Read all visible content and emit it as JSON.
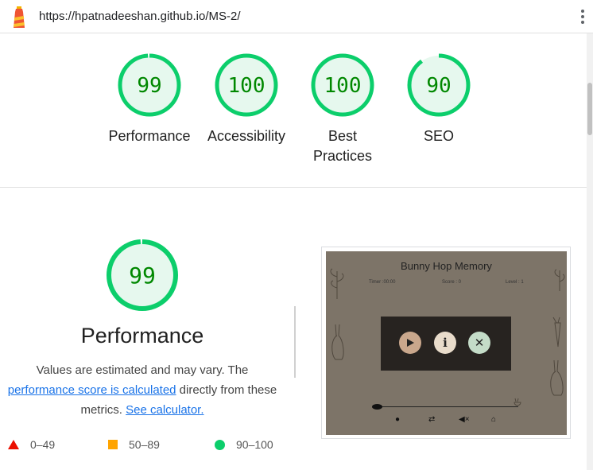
{
  "topbar": {
    "url": "https://hpatnadeeshan.github.io/MS-2/"
  },
  "gauges": [
    {
      "score": "99",
      "label": "Performance",
      "value": 99
    },
    {
      "score": "100",
      "label": "Accessibility",
      "value": 100
    },
    {
      "score": "100",
      "label_line1": "Best",
      "label_line2": "Practices",
      "value": 100
    },
    {
      "score": "90",
      "label": "SEO",
      "value": 90
    }
  ],
  "performance": {
    "score": "99",
    "value": 99,
    "title": "Performance",
    "desc_1": "Values are estimated and may vary. The",
    "desc_link_1": "performance score is calculated",
    "desc_2": " directly from these",
    "desc_3": "metrics. ",
    "desc_link_2": "See calculator."
  },
  "legend": [
    {
      "range": "0–49",
      "color": "#eb0f00"
    },
    {
      "range": "50–89",
      "color": "#ffa400"
    },
    {
      "range": "90–100",
      "color": "#0cce6b"
    }
  ],
  "thumbnail": {
    "title": "Bunny Hop Memory",
    "timer": "Timer :00:00",
    "score": "Score : 0",
    "level": "Level : 1",
    "buttons": [
      "play-icon",
      "info-icon",
      "close-icon"
    ],
    "bottom_icons": [
      "info-icon",
      "repeat-icon",
      "mute-icon",
      "home-icon"
    ]
  },
  "colors": {
    "pass": "#0cce6b",
    "pass_text": "#008800",
    "pass_fill": "#e6f8ee",
    "link": "#1a73e8"
  }
}
